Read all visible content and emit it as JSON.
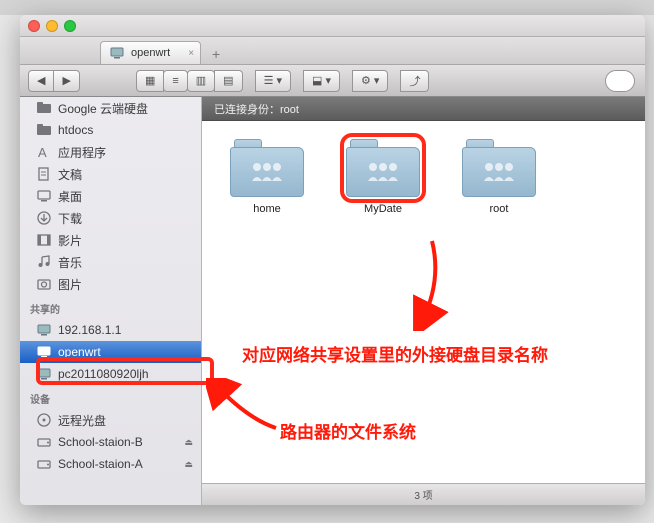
{
  "window": {
    "tab_title": "openwrt"
  },
  "sidebar": {
    "favorites": [
      {
        "label": "Google 云端硬盘",
        "icon": "folder-icon"
      },
      {
        "label": "htdocs",
        "icon": "folder-icon"
      },
      {
        "label": "应用程序",
        "icon": "apps-icon"
      },
      {
        "label": "文稿",
        "icon": "documents-icon"
      },
      {
        "label": "桌面",
        "icon": "desktop-icon"
      },
      {
        "label": "下载",
        "icon": "downloads-icon"
      },
      {
        "label": "影片",
        "icon": "movies-icon"
      },
      {
        "label": "音乐",
        "icon": "music-icon"
      },
      {
        "label": "图片",
        "icon": "photos-icon"
      }
    ],
    "shared_head": "共享的",
    "shared": [
      {
        "label": "192.168.1.1",
        "icon": "monitor-icon"
      },
      {
        "label": "openwrt",
        "icon": "monitor-icon",
        "selected": true
      },
      {
        "label": "pc2011080920ljh",
        "icon": "monitor-icon"
      }
    ],
    "devices_head": "设备",
    "devices": [
      {
        "label": "远程光盘",
        "icon": "disc-icon"
      },
      {
        "label": "School-staion-B",
        "icon": "drive-icon",
        "eject": true
      },
      {
        "label": "School-staion-A",
        "icon": "drive-icon",
        "eject": true
      }
    ]
  },
  "infobar": {
    "text": "已连接身份：root"
  },
  "folders": [
    {
      "name": "home"
    },
    {
      "name": "MyDate",
      "highlight": true
    },
    {
      "name": "root"
    }
  ],
  "statusbar": {
    "text": "3 项"
  },
  "annotations": {
    "top": "对应网络共享设置里的外接硬盘目录名称",
    "bottom": "路由器的文件系统"
  }
}
